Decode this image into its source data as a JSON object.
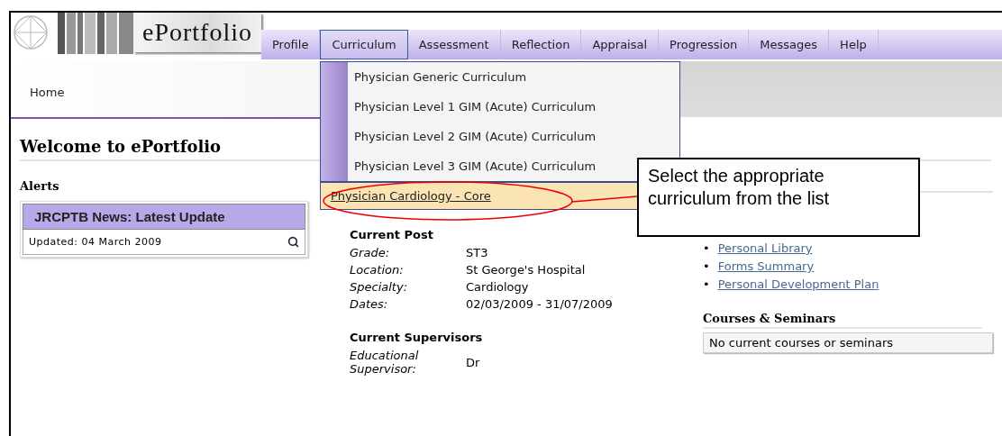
{
  "logo": {
    "text": "ePortfolio"
  },
  "tabs": [
    {
      "label": "Profile",
      "selected": false
    },
    {
      "label": "Curriculum",
      "selected": true
    },
    {
      "label": "Assessment",
      "selected": false
    },
    {
      "label": "Reflection",
      "selected": false
    },
    {
      "label": "Appraisal",
      "selected": false
    },
    {
      "label": "Progression",
      "selected": false
    },
    {
      "label": "Messages",
      "selected": false
    },
    {
      "label": "Help",
      "selected": false
    }
  ],
  "breadcrumb": "Home",
  "dropdown": {
    "items": [
      {
        "label": "Physician Generic Curriculum",
        "selected": false
      },
      {
        "label": "Physician Level 1 GIM (Acute) Curriculum",
        "selected": false
      },
      {
        "label": "Physician Level 2 GIM (Acute) Curriculum",
        "selected": false
      },
      {
        "label": "Physician Level 3 GIM (Acute) Curriculum",
        "selected": false
      },
      {
        "label": "Physician Cardiology - Core",
        "selected": true
      }
    ]
  },
  "page_title": "Welcome to ePortfolio",
  "alerts": {
    "title": "Alerts",
    "card": {
      "title": "JRCPTB News: Latest Update",
      "updated": "Updated: 04 March 2009"
    }
  },
  "current_post": {
    "title": "Current Post",
    "fields": [
      {
        "label": "Grade:",
        "value": "ST3"
      },
      {
        "label": "Location:",
        "value": "St George's Hospital"
      },
      {
        "label": "Specialty:",
        "value": "Cardiology"
      },
      {
        "label": "Dates:",
        "value": "02/03/2009 - 31/07/2009"
      }
    ]
  },
  "current_supervisors": {
    "title": "Current Supervisors",
    "fields": [
      {
        "label": "Educational Supervisor:",
        "value": "Dr"
      }
    ]
  },
  "links": [
    {
      "bullet": "•",
      "label": "Personal Library"
    },
    {
      "bullet": "•",
      "label": "Forms Summary"
    },
    {
      "bullet": "•",
      "label": "Personal Development Plan"
    }
  ],
  "courses": {
    "title": "Courses & Seminars",
    "empty_text": "No current courses or seminars"
  },
  "annotation": {
    "text": "Select the appropriate curriculum from the list"
  }
}
